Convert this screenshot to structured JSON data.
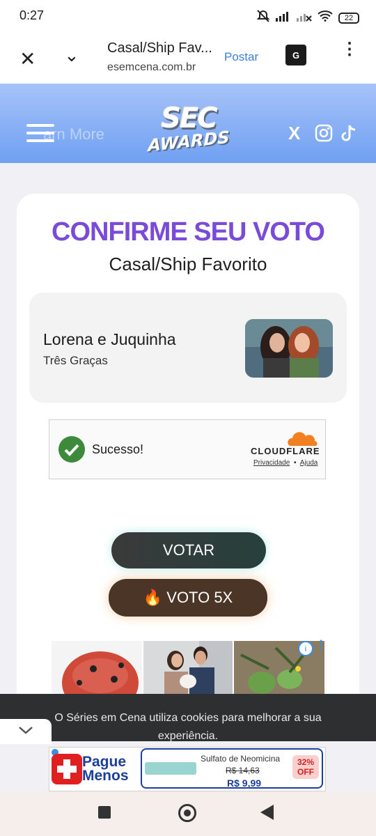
{
  "status_bar": {
    "time": "0:27",
    "battery": "22"
  },
  "browser": {
    "title": "Casal/Ship Fav...",
    "url": "esemcena.com.br",
    "postar": "Postar",
    "translate_icon_label": "G"
  },
  "header": {
    "learn_more": "arn More",
    "logo_top": "SEC",
    "logo_bottom": "AWARDS",
    "x_label": "X"
  },
  "main": {
    "title": "CONFIRME SEU VOTO",
    "subtitle": "Casal/Ship Favorito",
    "nominee_name": "Lorena e Juquinha",
    "nominee_show": "Três Graças"
  },
  "captcha": {
    "status": "Sucesso!",
    "brand": "CLOUDFLARE",
    "privacy": "Privacidade",
    "separator": "•",
    "help": "Ajuda"
  },
  "buttons": {
    "votar": "VOTAR",
    "voto5x": "🔥 VOTO 5X"
  },
  "cookie": {
    "text": "O Séries em Cena utiliza cookies para melhorar a sua experiência."
  },
  "bottom_ad": {
    "brand_line1": "Pague",
    "brand_line2": "Menos",
    "product": "Sulfato de Neomicina",
    "old_price": "R$ 14,63",
    "new_price": "R$ 9,99",
    "discount_line1": "32%",
    "discount_line2": "OFF"
  },
  "colors": {
    "accent_purple": "#7a4bd9",
    "header_blue": "#6fa0f2",
    "success_green": "#3d8a3d",
    "cloudflare_orange": "#f38020"
  }
}
